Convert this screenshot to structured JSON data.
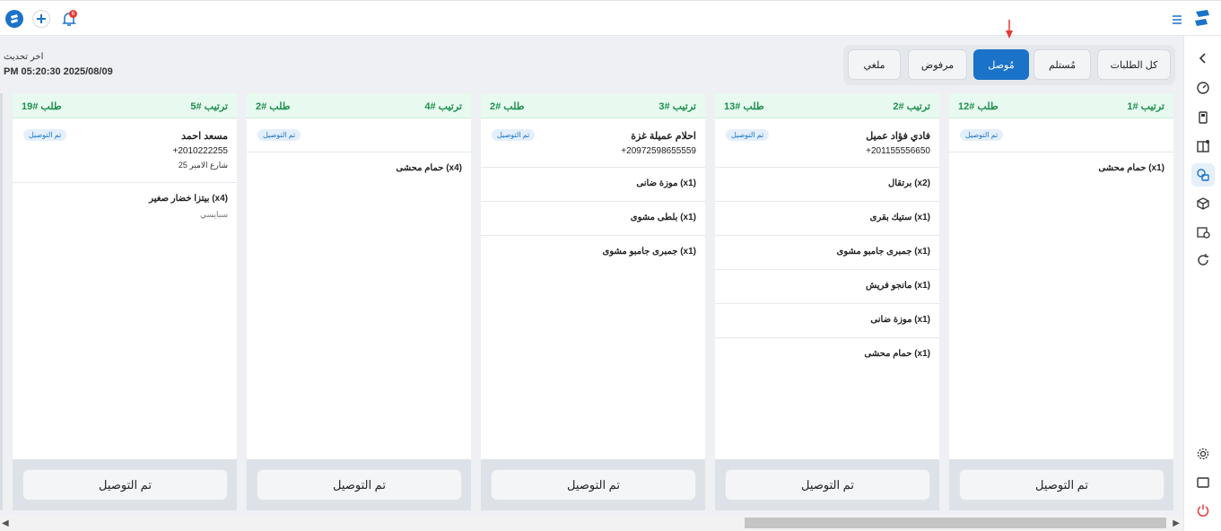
{
  "header": {
    "last_update_label": "اخر تحديث",
    "last_update_value": "PM 05:20:30 2025/08/09",
    "notification_count": "6"
  },
  "tabs": [
    {
      "label": "كل الطلبات",
      "active": false
    },
    {
      "label": "مُستلم",
      "active": false
    },
    {
      "label": "مُوصل",
      "active": true
    },
    {
      "label": "مرفوض",
      "active": false
    },
    {
      "label": "ملغي",
      "active": false
    }
  ],
  "columns": [
    {
      "order": "ترتيب #1",
      "request": "طلب #12",
      "status": "تم التوصيل",
      "items": [
        {
          "name": "حمام محشى (x1)"
        }
      ],
      "button": "تم التوصيل"
    },
    {
      "order": "ترتيب #2",
      "request": "طلب #13",
      "status": "تم التوصيل",
      "customer_name": "فادي فؤاد عميل",
      "customer_phone": "+201155556650",
      "items": [
        {
          "name": "برتقال (x2)"
        },
        {
          "name": "ستيك بقرى (x1)"
        },
        {
          "name": "جمبرى جامبو مشوى (x1)"
        },
        {
          "name": "مانجو فريش (x1)"
        },
        {
          "name": "موزة ضانى (x1)"
        },
        {
          "name": "حمام محشى (x1)"
        }
      ],
      "button": "تم التوصيل"
    },
    {
      "order": "ترتيب #3",
      "request": "طلب #2",
      "status": "تم التوصيل",
      "customer_name": "احلام عميلة غزة",
      "customer_phone": "+20972598655559",
      "items": [
        {
          "name": "موزة ضانى (x1)"
        },
        {
          "name": "بلطى مشوى (x1)"
        },
        {
          "name": "جمبرى جامبو مشوى (x1)"
        }
      ],
      "button": "تم التوصيل"
    },
    {
      "order": "ترتيب #4",
      "request": "طلب #2",
      "status": "تم التوصيل",
      "items": [
        {
          "name": "حمام محشى (x4)"
        }
      ],
      "button": "تم التوصيل"
    },
    {
      "order": "ترتيب #5",
      "request": "طلب #19",
      "status": "تم التوصيل",
      "customer_name": "مسعد احمد",
      "customer_phone": "+2010222255",
      "customer_address": "25 شارع الامير",
      "items": [
        {
          "name": "بيتزا خضار صغير (x4)",
          "note": "سبايسي"
        }
      ],
      "button": "تم التوصيل"
    }
  ],
  "colors": {
    "accent": "#1a73c8",
    "header_green": "#1e8f4e",
    "header_bg": "#e8faf0",
    "alert": "#e53935"
  },
  "icons": {
    "top_left": [
      "app-logo-icon",
      "plus-icon",
      "bell-icon"
    ],
    "top_right": [
      "menu-icon",
      "brand-logo-icon"
    ],
    "sidebar": [
      "chevron-left-icon",
      "dashboard-icon",
      "pos-icon",
      "reports-icon",
      "delivery-icon",
      "box-icon",
      "settings-doc-icon",
      "refresh-icon",
      "gear-icon",
      "window-icon",
      "power-icon"
    ]
  }
}
